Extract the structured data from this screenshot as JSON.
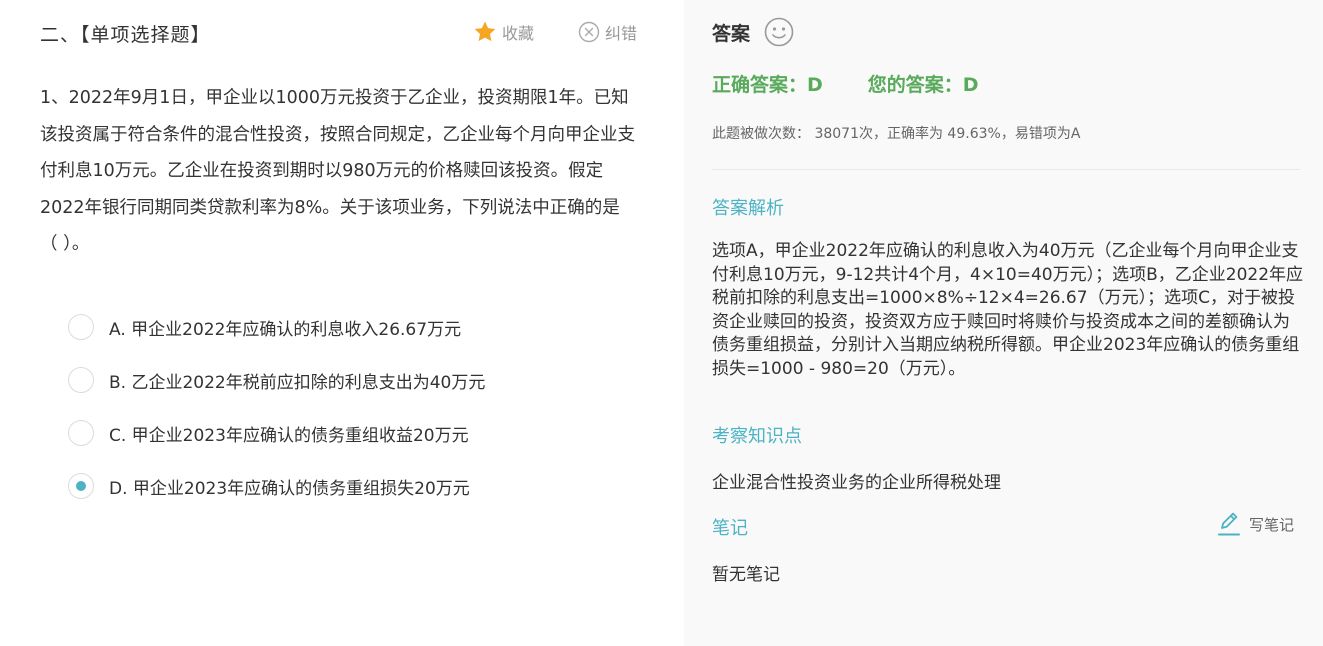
{
  "question": {
    "section_title": "二、【单项选择题】",
    "favorite_label": "收藏",
    "report_error_label": "纠错",
    "stem": "1、2022年9月1日，甲企业以1000万元投资于乙企业，投资期限1年。已知该投资属于符合条件的混合性投资，按照合同规定，乙企业每个月向甲企业支付利息10万元。乙企业在投资到期时以980万元的价格赎回该投资。假定2022年银行同期同类贷款利率为8%。关于该项业务，下列说法中正确的是（   ）。",
    "options": [
      {
        "label": "A. 甲企业2022年应确认的利息收入26.67万元",
        "selected": false
      },
      {
        "label": "B. 乙企业2022年税前应扣除的利息支出为40万元",
        "selected": false
      },
      {
        "label": "C. 甲企业2023年应确认的债务重组收益20万元",
        "selected": false
      },
      {
        "label": "D. 甲企业2023年应确认的债务重组损失20万元",
        "selected": true
      }
    ]
  },
  "answer": {
    "title": "答案",
    "correct_answer": "正确答案：D",
    "your_answer": "您的答案：D",
    "stats": "此题被做次数： 38071次，正确率为 49.63%，易错项为A",
    "analysis_label": "答案解析",
    "analysis": "选项A，甲企业2022年应确认的利息收入为40万元（乙企业每个月向甲企业支付利息10万元，9-12共计4个月，4×10=40万元）；选项B，乙企业2022年应税前扣除的利息支出=1000×8%÷12×4=26.67（万元）；选项C，对于被投资企业赎回的投资，投资双方应于赎回时将赎价与投资成本之间的差额确认为债务重组损益，分别计入当期应纳税所得额。甲企业2023年应确认的债务重组损失=1000 - 980=20（万元）。",
    "knowledge_label": "考察知识点",
    "knowledge": "企业混合性投资业务的企业所得税处理",
    "notes_label": "笔记",
    "write_note_label": "写笔记",
    "no_notes": "暂无笔记"
  },
  "colors": {
    "accent": "#4bb3c4",
    "correct_green": "#5aaa5c",
    "star": "#f5a623",
    "right_panel_bg": "#f9f9f9"
  }
}
